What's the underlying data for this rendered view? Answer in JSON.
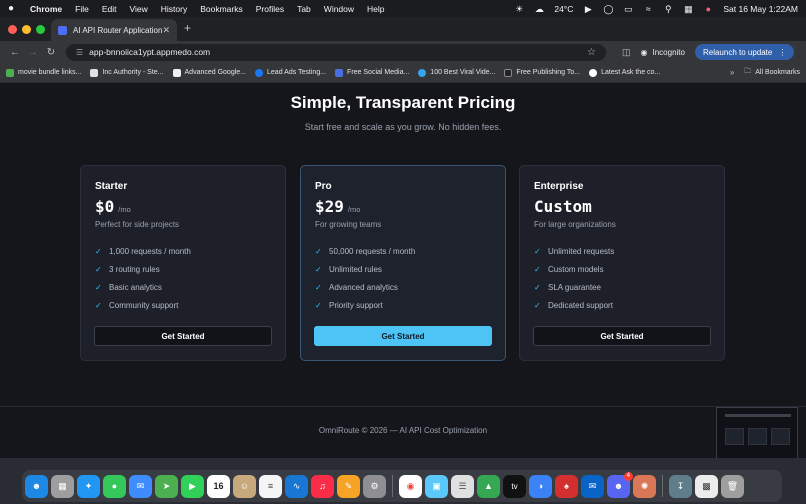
{
  "menubar": {
    "app": "Chrome",
    "items": [
      "File",
      "Edit",
      "View",
      "History",
      "Bookmarks",
      "Profiles",
      "Tab",
      "Window",
      "Help"
    ],
    "temperature": "24°C",
    "datetime": "Sat 16 May  1:22AM"
  },
  "browser": {
    "tab_title": "AI API Router Application",
    "url": "app-bnnoiica1ypt.appmedo.com",
    "incognito_label": "Incognito",
    "relaunch_label": "Relaunch to update",
    "bookmarks": [
      {
        "label": "movie bundle links...",
        "color": "#4caf50"
      },
      {
        "label": "Inc Authority - Ste...",
        "color": "#e0e0e0"
      },
      {
        "label": "Advanced Google...",
        "color": "#f0f0f0"
      },
      {
        "label": "Lead Ads Testing...",
        "color": "#1877f2"
      },
      {
        "label": "Free Social Media...",
        "color": "#4a6ee0"
      },
      {
        "label": "100 Best Viral Vide...",
        "color": "#35a4ec"
      },
      {
        "label": "Free Publishing To...",
        "color": "#222222"
      },
      {
        "label": "Latest Ask the co...",
        "color": "#ffffff"
      }
    ],
    "all_bookmarks_label": "All Bookmarks"
  },
  "page": {
    "title": "Simple, Transparent Pricing",
    "subtitle": "Start free and scale as you grow. No hidden fees.",
    "plans": [
      {
        "name": "Starter",
        "price": "$0",
        "period": "/mo",
        "description": "Perfect for side projects",
        "features": [
          "1,000 requests / month",
          "3 routing rules",
          "Basic analytics",
          "Community support"
        ],
        "cta": "Get Started"
      },
      {
        "name": "Pro",
        "price": "$29",
        "period": "/mo",
        "description": "For growing teams",
        "features": [
          "50,000 requests / month",
          "Unlimited rules",
          "Advanced analytics",
          "Priority support"
        ],
        "cta": "Get Started"
      },
      {
        "name": "Enterprise",
        "price": "Custom",
        "period": "",
        "description": "For large organizations",
        "features": [
          "Unlimited requests",
          "Custom models",
          "SLA guarantee",
          "Dedicated support"
        ],
        "cta": "Get Started"
      }
    ],
    "footer": "OmniRoute © 2026 — AI API Cost Optimization"
  },
  "colors": {
    "accent": "#4ec3f5",
    "check": "#38bdf8",
    "background": "#14161c",
    "card": "#1d2029"
  },
  "dock": {
    "calendar_day": "16",
    "discord_badge": "4",
    "apple_tv_label": "tv",
    "apps": [
      {
        "name": "finder-icon",
        "color": "#1e88e5"
      },
      {
        "name": "launchpad-icon",
        "color": "#9e9e9e"
      },
      {
        "name": "safari-icon",
        "color": "#2196f3"
      },
      {
        "name": "messages-icon",
        "color": "#34c759"
      },
      {
        "name": "mail-icon",
        "color": "#3f8cff"
      },
      {
        "name": "maps-icon",
        "color": "#4caf50"
      },
      {
        "name": "facetime-icon",
        "color": "#30d158"
      },
      {
        "name": "calendar-icon",
        "color": "#ffffff"
      },
      {
        "name": "contacts-icon",
        "color": "#c8a97e"
      },
      {
        "name": "reminders-icon",
        "color": "#f5f5f5"
      },
      {
        "name": "freeform-icon",
        "color": "#1976d2"
      },
      {
        "name": "music-icon",
        "color": "#fa2d48"
      },
      {
        "name": "pages-icon",
        "color": "#f7a325"
      },
      {
        "name": "settings-icon",
        "color": "#8e8e93"
      },
      {
        "name": "chrome-icon",
        "color": "#ea4335"
      },
      {
        "name": "preview-icon",
        "color": "#5ac8fa"
      },
      {
        "name": "notes-icon",
        "color": "#e0e0e0"
      },
      {
        "name": "numbers-icon",
        "color": "#34a853"
      },
      {
        "name": "appletv-icon",
        "color": "#111111"
      },
      {
        "name": "vpn-icon",
        "color": "#3b82f6"
      },
      {
        "name": "acrobat-icon",
        "color": "#d32f2f"
      },
      {
        "name": "outlook-icon",
        "color": "#0a64c8"
      },
      {
        "name": "discord-icon",
        "color": "#5865f2"
      },
      {
        "name": "claude-icon",
        "color": "#d97757"
      },
      {
        "name": "downloads-icon",
        "color": "#607d8b"
      },
      {
        "name": "trash-icon",
        "color": "#9e9e9e"
      }
    ]
  }
}
